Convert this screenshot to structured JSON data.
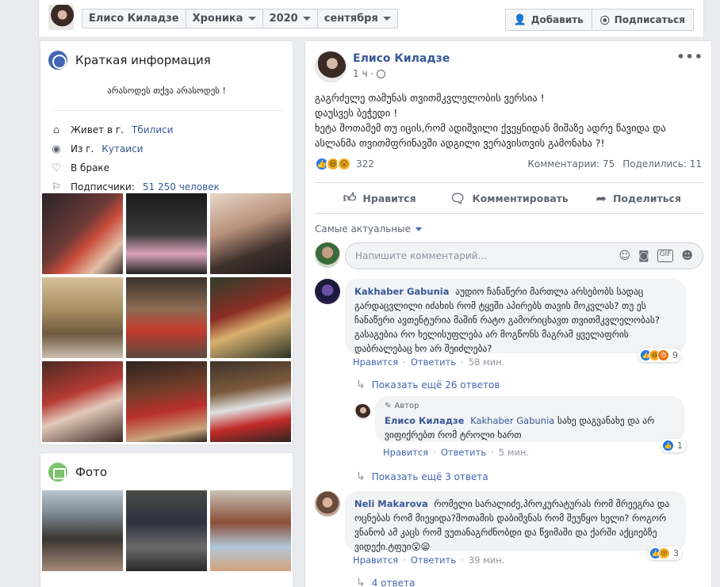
{
  "topbar": {
    "profile_name": "Елисо Киладзе",
    "section": "Хроника",
    "year": "2020",
    "month": "сентября",
    "add_label": "Добавить",
    "subscribe_label": "Подписаться"
  },
  "intro": {
    "title": "Краткая информация",
    "bio": "არასოდეს თქვა არასოდეს !",
    "lives_label": "Живет в г.",
    "lives_city": "Тбилиси",
    "from_label": "Из г.",
    "from_city": "Кутаиси",
    "relationship": "В браке",
    "followers_label": "Подписчики:",
    "followers_value": "51 250 человек"
  },
  "photos": {
    "title": "Фото"
  },
  "post": {
    "author": "Елисо Киладзе",
    "time": "1 ч",
    "dots": "•••",
    "text_lines": {
      "l1": "გაგრძელე თამუნას თვითმკვლელობის ვერსია !",
      "l2": "დაუსვეს ბეჭედი !",
      "l3": "ხეტა შოთამემ თუ იცის,რომ ადიშვილი ქვეყნიდან მიშაზე ადრე წავიდა და",
      "l4": "ასლანმა თვითმფრინავში ადგილი ვერავისთვის გამონახა ?!"
    },
    "reactions_count": "322",
    "comments_stat": "Комментарии: 75",
    "shares_stat": "Поделились: 11",
    "like_label": "Нравится",
    "comment_label": "Комментировать",
    "share_label": "Поделиться"
  },
  "comments_section": {
    "sort_label": "Самые актуальные",
    "input_placeholder": "Напишите комментарий...",
    "comments": [
      {
        "name": "Kakhaber Gabunia",
        "text": "აუდიო ჩანაწერი მართლა არსებობს სადაც გარდაცვლილი იძახის რომ ტყეში აპირებს თავის მოკვლას? თუ ეს ჩანაწერი ავთენტურია მაშინ რატო გამორიცხავთ თვითმკვლელობას? გასაგებია რო ხელისუფლება არ მოგწონს მაგრამ ყველაფრის დაბრალებაც ხო არ შეიძლება?",
        "like": "Нравится",
        "reply": "Ответить",
        "time": "58 мин.",
        "reactions": "9",
        "more": "Показать ещё 26 ответов"
      },
      {
        "author_tag": "Автор",
        "name": "Елисо Киладзе",
        "mention": "Kakhaber Gabunia",
        "text": "სახე დაგვანახე და არ ვიფიქრებთ რომ ტროლი ხართ",
        "like": "Нравится",
        "reply": "Ответить",
        "time": "5 мин.",
        "reactions": "1",
        "more": "Показать ещё 3 ответа"
      },
      {
        "name": "Neli Makarova",
        "text": "რომელი სარალიძე,პროკურატურას რომ შრეეგრა და ოცნებას რომ მიეყიდა?შოთამის დაბიშვნას რომ შეუწყო ხელი? როგორ ვნანობ ამ კაცს რომ ვუთანაგრძნობდი და წვიმაში და ქარში აქციებზე ვიდექი.ტფუი😮😦",
        "like": "Нравится",
        "reply": "Ответить",
        "time": "39 мин.",
        "reactions": "3",
        "more": "4 ответа"
      }
    ]
  },
  "colors": {
    "link": "#385898",
    "fb_blue": "#4267b2",
    "bg": "#e9ebee"
  }
}
